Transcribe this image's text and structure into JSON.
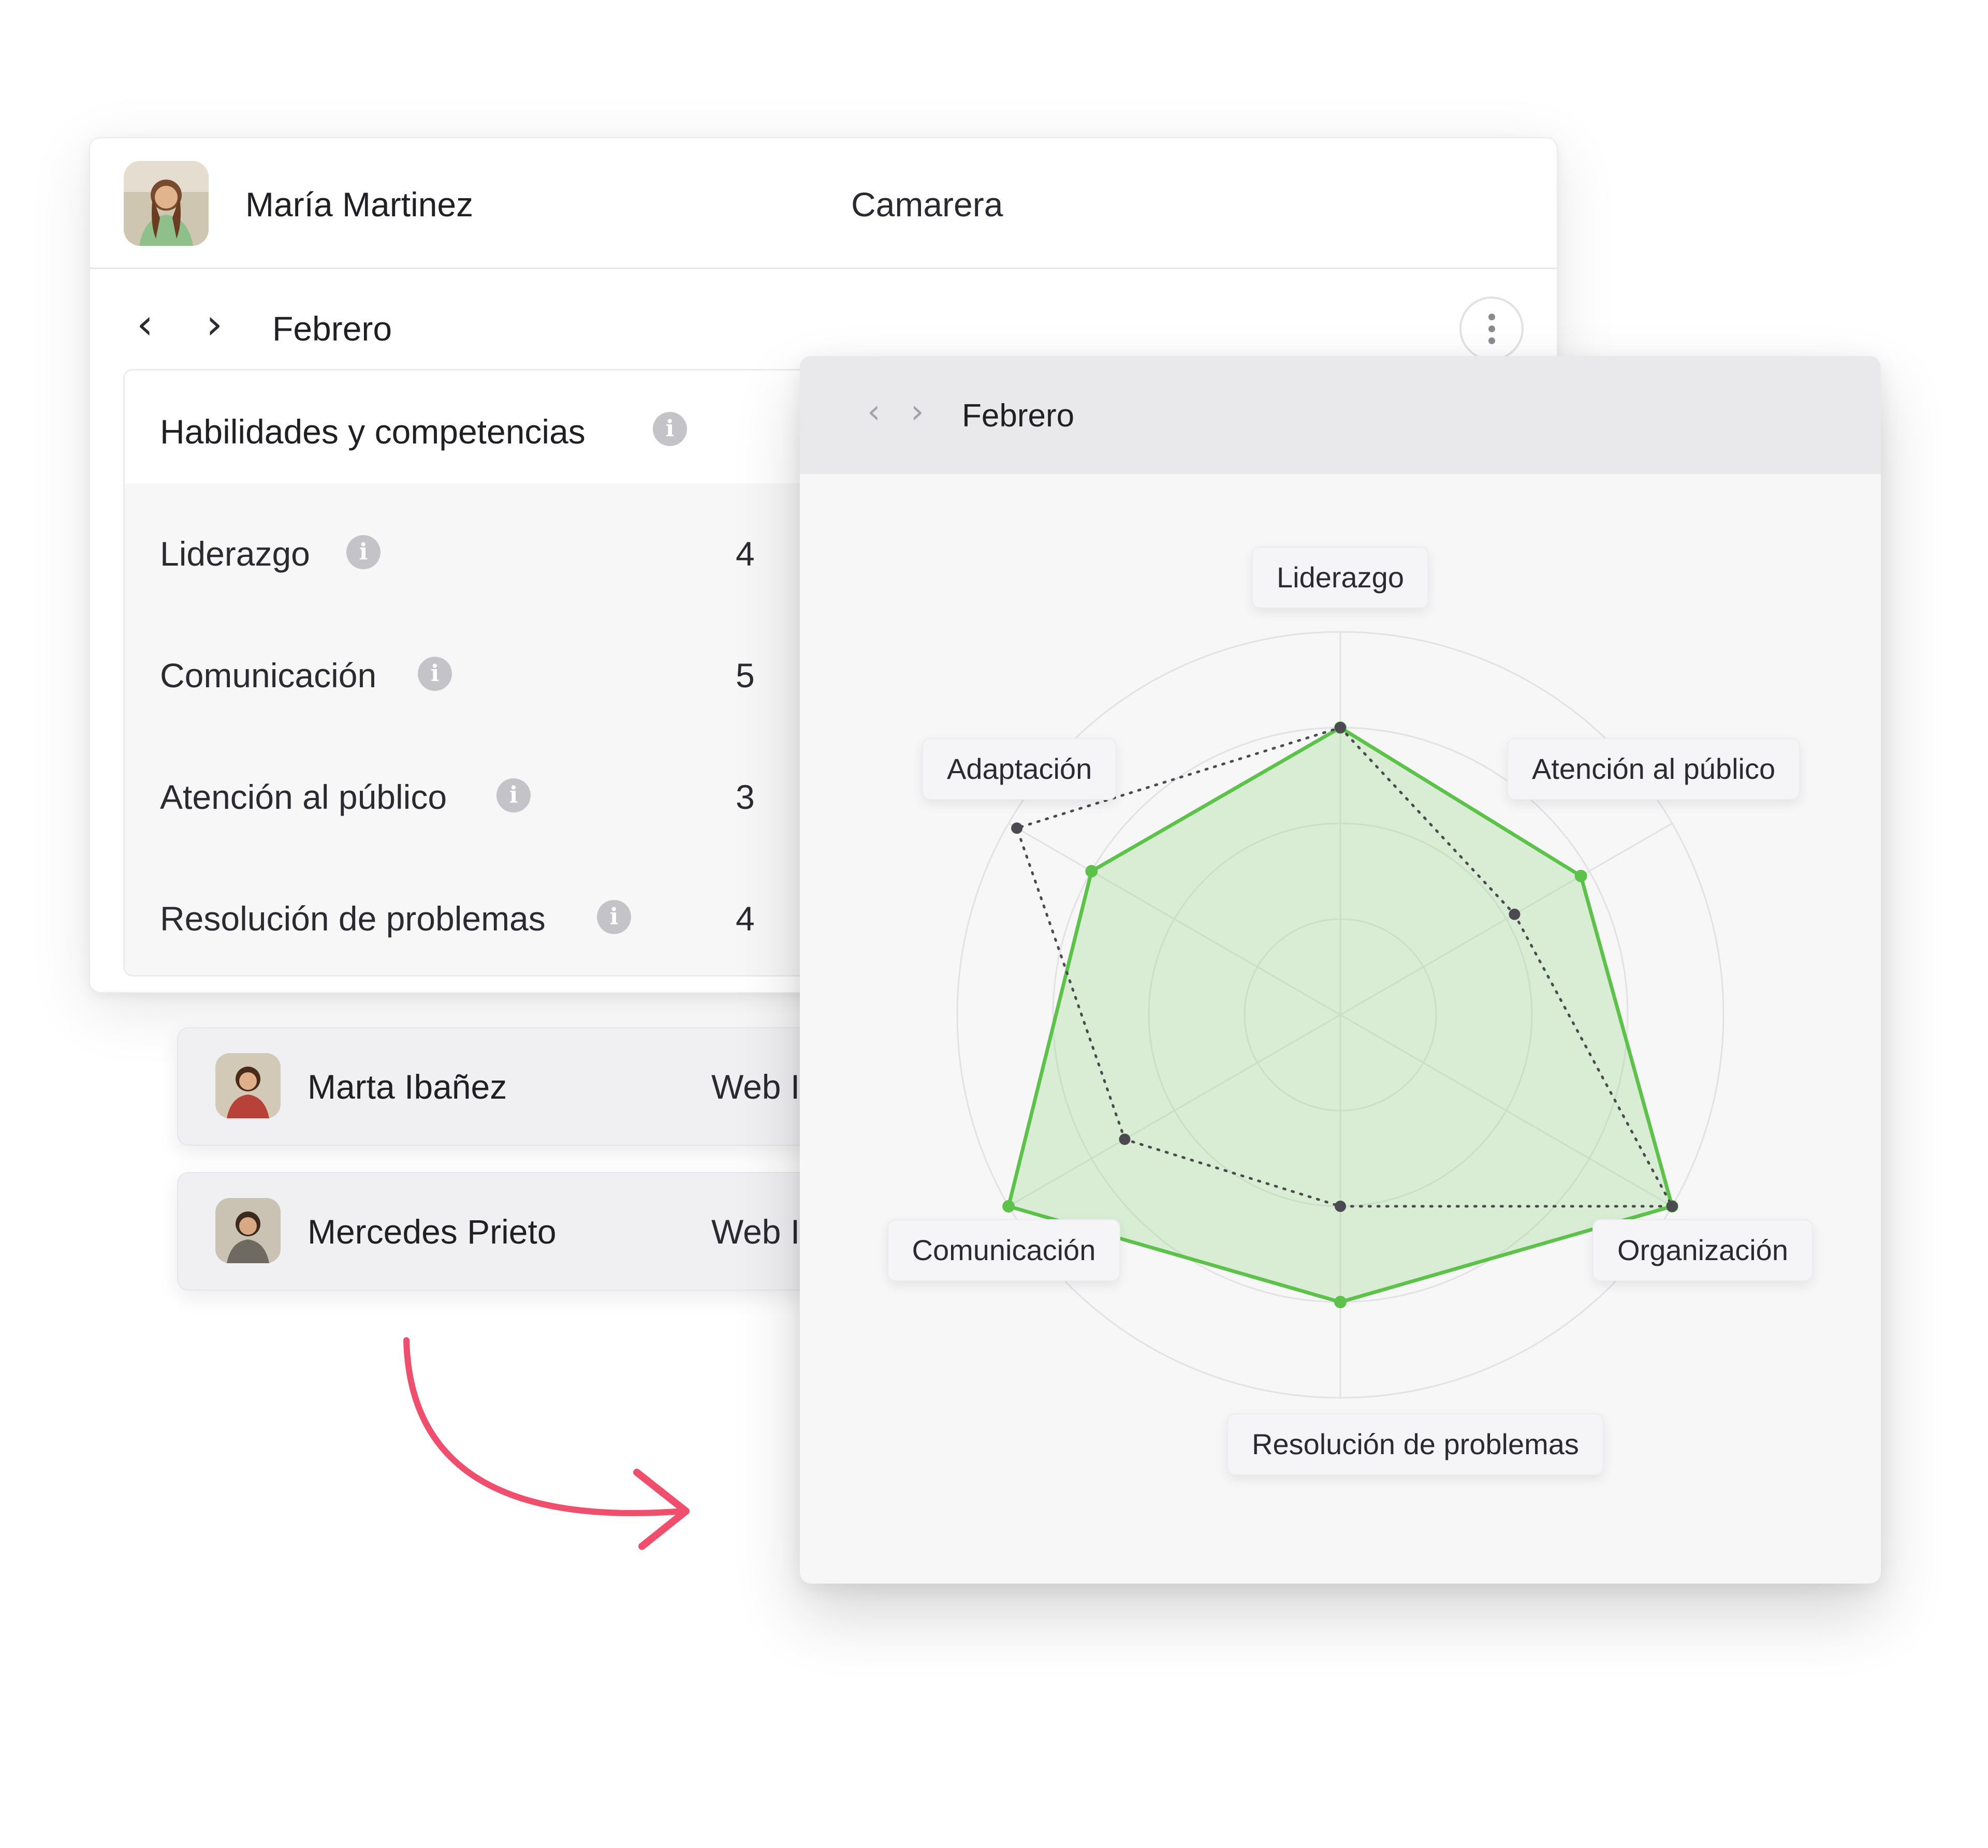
{
  "employee": {
    "name": "María Martinez",
    "role": "Camarera"
  },
  "period": {
    "month": "Febrero"
  },
  "skills": {
    "title": "Habilidades y competencias",
    "items": [
      {
        "label": "Liderazgo",
        "value": "4"
      },
      {
        "label": "Comunicación",
        "value": "5"
      },
      {
        "label": "Atención al público",
        "value": "3"
      },
      {
        "label": "Resolución de problemas",
        "value": "4"
      }
    ]
  },
  "employee_list": [
    {
      "name": "Marta Ibañez",
      "role": "Web I"
    },
    {
      "name": "Mercedes Prieto",
      "role": "Web I"
    }
  ],
  "radar": {
    "month": "Febrero",
    "colors": {
      "current": "#5cc24a",
      "current_fill": "#9fda8f",
      "previous": "#4a4a50",
      "grid": "#e2e2e6"
    }
  },
  "chart_data": {
    "type": "radar",
    "categories": [
      "Liderazgo",
      "Atención al público",
      "Organización",
      "Resolución de problemas",
      "Comunicación",
      "Adaptación"
    ],
    "rlim": [
      0,
      4
    ],
    "series": [
      {
        "values": [
          3,
          2.9,
          4,
          3,
          4,
          3
        ]
      },
      {
        "values": [
          3,
          2.1,
          4,
          2,
          2.6,
          3.9
        ]
      }
    ]
  }
}
